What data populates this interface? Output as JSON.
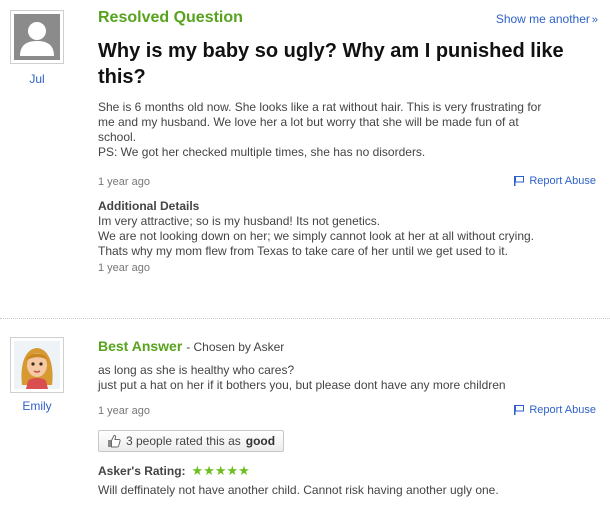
{
  "question": {
    "status": "Resolved Question",
    "show_another": "Show me another",
    "show_another_icon": "raquo",
    "user_name": "Jul",
    "title": "Why is my baby so ugly? Why am I punished like this?",
    "body_lines": [
      "She is 6 months old now. She looks like a rat without hair. This is very frustrating for",
      "me and my husband. We love her a lot but worry that she will be made fun of at",
      "school.",
      "PS: We got her checked multiple times, she has no disorders."
    ],
    "time": "1 year ago",
    "report_abuse": "Report Abuse",
    "additional_details": {
      "heading": "Additional Details",
      "lines": [
        "Im very attractive; so is my husband! Its not genetics.",
        "We are not looking down on her; we simply cannot look at her at all without crying.",
        "Thats why my mom flew from Texas to take care of her until we get used to it."
      ],
      "time": "1 year ago"
    }
  },
  "answer": {
    "label": "Best Answer",
    "chosen_by": "- Chosen by Asker",
    "user_name": "Emily",
    "body_lines": [
      "as long as she is healthy who cares?",
      "just put a hat on her if it bothers you, but please dont have any more children"
    ],
    "time": "1 year ago",
    "report_abuse": "Report Abuse",
    "rated_prefix": "3 people rated this as",
    "rated_value": "good",
    "askers_rating_label": "Asker's Rating:",
    "stars": "★★★★★",
    "star_rating": 5,
    "rating_comment": "Will deffinately not have another child. Cannot risk having another ugly one."
  },
  "colors": {
    "green": "#57a31d",
    "link_blue": "#2f62c8",
    "star_green": "#6cbf1f"
  }
}
